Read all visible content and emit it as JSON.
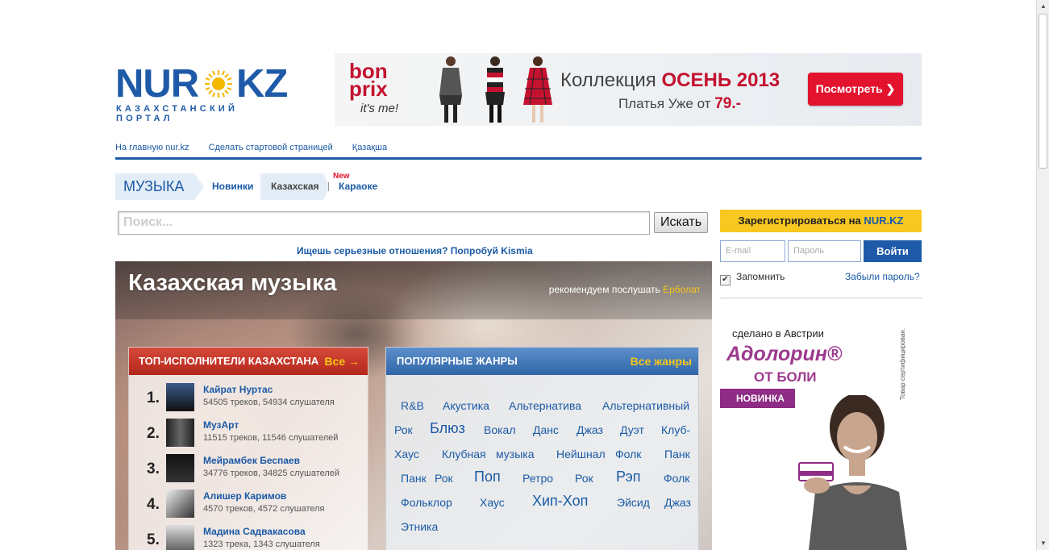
{
  "logo": {
    "part1": "NUR",
    "part2": "KZ",
    "tagline": "КАЗАХСТАНСКИЙ ПОРТАЛ"
  },
  "banner": {
    "brand_line1": "bon",
    "brand_line2": "prix",
    "brand_slogan": "it's me!",
    "title_prefix": "Коллекция",
    "title_highlight": "ОСЕНЬ 2013",
    "subtitle_prefix": "Платья Уже от",
    "subtitle_price": "79.-",
    "button": "Посмотреть ❯",
    "colors": {
      "accent": "#e3122d"
    }
  },
  "topnav": [
    "На главную nur.kz",
    "Сделать стартовой страницей",
    "Қазақша"
  ],
  "section": {
    "label": "МУЗЫКА",
    "tabs": [
      "Новинки",
      "Казахская",
      "Караоке"
    ],
    "new_badge": "New"
  },
  "search": {
    "placeholder": "Поиск...",
    "button": "Искать"
  },
  "promo_link": "Ищешь серьезные отношения? Попробуй Kismia",
  "hero": {
    "title": "Казахская музыка",
    "recommend_prefix": "рекомендуем послушать",
    "recommend_name": "Ерболат"
  },
  "top_artists": {
    "heading": "ТОП-ИСПОЛНИТЕЛИ КАЗАХСТАНА",
    "all_link": "Все →",
    "items": [
      {
        "rank": "1.",
        "name": "Кайрат Нуртас",
        "stats": "54505 треков, 54934 слушателя"
      },
      {
        "rank": "2.",
        "name": "МузАрт",
        "stats": "11515 треков, 11546 слушателей"
      },
      {
        "rank": "3.",
        "name": "Мейрамбек Беспаев",
        "stats": "34776 треков, 34825 слушателей"
      },
      {
        "rank": "4.",
        "name": "Алишер Каримов",
        "stats": "4570 треков, 4572 слушателя"
      },
      {
        "rank": "5.",
        "name": "Мадина Садвакасова",
        "stats": "1323 трека, 1343 слушателя"
      }
    ]
  },
  "genres": {
    "heading": "ПОПУЛЯРНЫЕ ЖАНРЫ",
    "all_link": "Все жанры",
    "items": [
      "R&B",
      "Акустика",
      "Альтернатива",
      "Альтернативный",
      "Рок",
      "Блюз",
      "Вокал",
      "Данс",
      "Джаз",
      "Дуэт",
      "Клуб-",
      "Хаус",
      "Клубная",
      "музыка",
      "Нейшнал",
      "Фолк",
      "Панк",
      "Панк",
      "Рок",
      "Поп",
      "Ретро",
      "Рок",
      "Рэп",
      "Фолк",
      "Фольклор",
      "Хаус",
      "Хип-Хоп",
      "Эйсид",
      "Джаз",
      "Этника"
    ]
  },
  "auth": {
    "register_prefix": "Зарегистрироваться на",
    "register_site": "NUR.KZ",
    "email_placeholder": "E-mail",
    "password_placeholder": "Пароль",
    "login_button": "Войти",
    "remember": "Запомнить",
    "forgot": "Забыли пароль?"
  },
  "side_ad": {
    "line1": "сделано в Австрии",
    "brand": "Адолорин®",
    "line2": "ОТ БОЛИ",
    "badge": "НОВИНКА",
    "vertical": "Товар сертифицирован."
  }
}
